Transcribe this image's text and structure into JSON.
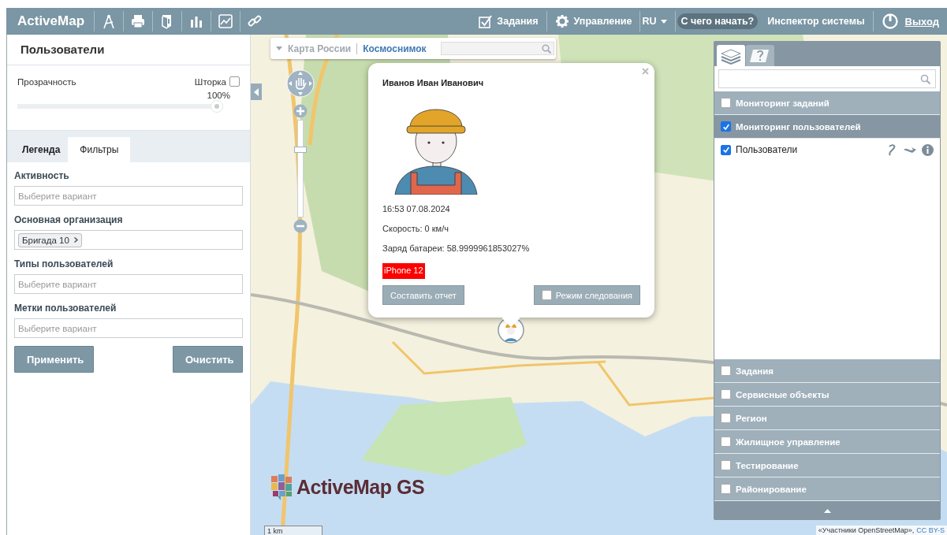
{
  "header": {
    "logo": "ActiveMap",
    "menu": [
      {
        "kind": "link",
        "label": "Задания"
      },
      {
        "kind": "link",
        "label": "Управление"
      },
      {
        "kind": "dropdown",
        "label": "RU"
      },
      {
        "kind": "pill",
        "label": "С чего начать?"
      },
      {
        "kind": "link",
        "label": "Инспектор системы"
      },
      {
        "kind": "logout",
        "label": "Выход"
      }
    ]
  },
  "left_panel": {
    "title": "Пользователи",
    "opacity": {
      "label": "Прозрачность",
      "curtain_label": "Шторка",
      "curtain_checked": false,
      "value": "100%",
      "level": 1
    },
    "tabs": [
      {
        "label": "Легенда",
        "selected": false
      },
      {
        "label": "Фильтры",
        "selected": true
      }
    ],
    "filters": [
      {
        "label": "Активность",
        "placeholder": "Выберите вариант"
      },
      {
        "label": "Основная организация",
        "tags": [
          "Бригада 10"
        ]
      },
      {
        "label": "Типы пользователей",
        "placeholder": "Выберите вариант"
      },
      {
        "label": "Метки пользователей",
        "placeholder": "Выберите вариант"
      }
    ],
    "buttons": [
      {
        "label": "Применить"
      },
      {
        "label": "Очистить"
      }
    ]
  },
  "map": {
    "base_layers": [
      {
        "label": "Карта России",
        "selected": false
      },
      {
        "label": "Космоснимок",
        "selected": true
      }
    ],
    "zoom": {
      "level": 0.7
    },
    "popup": {
      "name": "Иванов Иван Иванович",
      "lines": [
        "16:53 07.08.2024",
        "Скорость: 0 км/ч",
        "Заряд батареи: 58.9999961853027%"
      ],
      "tags": [
        {
          "label": "iPhone 12",
          "color": "#ff0000"
        }
      ],
      "report_button": "Составить отчет",
      "follow": {
        "label": "Режим следования",
        "checked": false
      }
    },
    "layer_panel": {
      "tabs": [
        {
          "selected": true
        },
        {
          "selected": false
        }
      ],
      "groups": [
        {
          "label": "Мониторинг заданий",
          "checked": false,
          "expanded": false
        },
        {
          "label": "Мониторинг пользователей",
          "checked": true,
          "expanded": true,
          "children": [
            {
              "label": "Пользователи",
              "checked": true
            }
          ]
        },
        {
          "label": "Задания",
          "checked": false,
          "expanded": false
        },
        {
          "label": "Сервисные объекты",
          "checked": false,
          "expanded": false
        },
        {
          "label": "Регион",
          "checked": false,
          "expanded": false
        },
        {
          "label": "Жилищное управление",
          "checked": false,
          "expanded": false
        },
        {
          "label": "Тестирование",
          "checked": false,
          "expanded": false
        },
        {
          "label": "Районирование",
          "checked": false,
          "expanded": false
        }
      ]
    },
    "logo": "ActiveMap GS",
    "scale": "1 km",
    "attribution": "«Участники OpenStreetMap»,",
    "attribution_link": "CC BY-S"
  }
}
